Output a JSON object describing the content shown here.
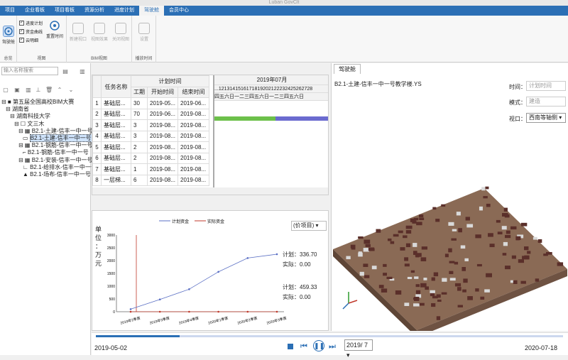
{
  "window": {
    "title": "Luban GovClt"
  },
  "menu": [
    {
      "label": "项目",
      "active": false
    },
    {
      "label": "企业看板",
      "active": false
    },
    {
      "label": "项目看板",
      "active": false
    },
    {
      "label": "资源分析",
      "active": false
    },
    {
      "label": "进度计划",
      "active": false
    },
    {
      "label": "驾驶舱",
      "active": true
    },
    {
      "label": "会员中心",
      "active": false
    }
  ],
  "ribbon": {
    "cockpit_label": "驾驶舱",
    "group1_label": "总览",
    "chk_progress": "进度计划",
    "chk_fund": "资金曲线",
    "chk_cloud": "云明细",
    "reset_label": "重置时间",
    "group2_label": "视图",
    "new_window": "新建视口",
    "view_effect": "视图效果",
    "close_view": "关闭视图",
    "group3_label": "BIM视图",
    "settings": "设置",
    "group4_label": "播放时间"
  },
  "tree": {
    "search_placeholder": "输入名称搜索",
    "items": [
      {
        "label": "第五届全国高校BIM大赛",
        "prefix": "⊟ ■ ",
        "level": 0
      },
      {
        "label": "湖南省",
        "prefix": "⊟ ",
        "level": 1
      },
      {
        "label": "湖南科技大学",
        "prefix": "⊟ ",
        "level": 2
      },
      {
        "label": "文三木",
        "prefix": "⊟ ☐ ",
        "level": 3
      },
      {
        "label": "B2.1-土建-信丰一中一号教",
        "prefix": "⊟ ▦ ",
        "level": 4
      },
      {
        "label": "B2.1-土建-信丰一中一号",
        "prefix": "▭ ",
        "level": 5,
        "selected": true
      },
      {
        "label": "B2.1-钢筋-信丰一中一号教",
        "prefix": "⊟ ▦ ",
        "level": 4
      },
      {
        "label": "B2.1-钢筋-信丰一中一号",
        "prefix": "⌐ ",
        "level": 5
      },
      {
        "label": "B2.1-安装-信丰一中一号教",
        "prefix": "⊟ ▦ ",
        "level": 4
      },
      {
        "label": "B2.1-给排水-信丰一中一号",
        "prefix": "∟ ",
        "level": 5
      },
      {
        "label": "B2.1-场布-信丰一中一号",
        "prefix": "▲ ",
        "level": 5
      }
    ]
  },
  "gantt": {
    "hdr_task": "任务名称",
    "hdr_plan": "计划时间",
    "hdr_dur": "工期",
    "hdr_start": "开始时间",
    "hdr_end": "结束时间",
    "month": "2019年07月",
    "days": "...1213141516171819202122232425262728",
    "weekdays": "四五六日一二三四五六日一二三四五六日",
    "rows": [
      {
        "id": "1",
        "name": "基础层...",
        "dur": "30",
        "start": "2019-05...",
        "end": "2019-06..."
      },
      {
        "id": "2",
        "name": "基础层...",
        "dur": "70",
        "start": "2019-06...",
        "end": "2019-08..."
      },
      {
        "id": "3",
        "name": "基础层...",
        "dur": "3",
        "start": "2019-08...",
        "end": "2019-08..."
      },
      {
        "id": "4",
        "name": "基础层...",
        "dur": "3",
        "start": "2019-08...",
        "end": "2019-08..."
      },
      {
        "id": "5",
        "name": "基础层...",
        "dur": "2",
        "start": "2019-08...",
        "end": "2019-08..."
      },
      {
        "id": "6",
        "name": "基础层...",
        "dur": "2",
        "start": "2019-08...",
        "end": "2019-08..."
      },
      {
        "id": "7",
        "name": "基础层...",
        "dur": "1",
        "start": "2019-08...",
        "end": "2019-08..."
      },
      {
        "id": "8",
        "name": "一层梯...",
        "dur": "6",
        "start": "2019-08...",
        "end": "2019-08..."
      }
    ]
  },
  "chart": {
    "unit_lines": [
      "单",
      "位",
      "：",
      "万",
      "元"
    ],
    "dropdown": "(价项目)",
    "legend_plan": "计划资金",
    "legend_actual": "实际资金",
    "plan_label1": "计划：336.70",
    "actual_label1": "实际：0.00",
    "plan_label2": "计划：459.33",
    "actual_label2": "实际：0.00"
  },
  "chart_data": {
    "type": "line",
    "categories": [
      "2019年2季度",
      "2019年3季度",
      "2019年4季度",
      "2020年1季度",
      "2020年2季度",
      "2020年3季度"
    ],
    "series": [
      {
        "name": "计划资金",
        "values": [
          100,
          480,
          880,
          1560,
          2100,
          2250
        ]
      },
      {
        "name": "实际资金",
        "values": [
          0,
          0,
          0,
          0,
          0,
          0
        ]
      }
    ],
    "ylim": [
      0,
      3000
    ],
    "yticks": [
      0,
      500,
      1000,
      1500,
      2000,
      2500,
      3000
    ],
    "colors": {
      "plan": "#5a6fc4",
      "actual": "#c0392b"
    }
  },
  "viewer": {
    "tab_label": "驾驶舱",
    "model_name": "B2.1-土建-信丰一中一号教学楼.YS",
    "time_label": "时间：",
    "time_value": "计划时间",
    "mode_label": "模式：",
    "mode_value": "建造",
    "view_label": "视口：",
    "view_value": "西南等轴侧"
  },
  "timeline": {
    "start": "2019-05-02",
    "end": "2020-07-18",
    "current": "2019/ 7",
    "progress": 0.18
  }
}
